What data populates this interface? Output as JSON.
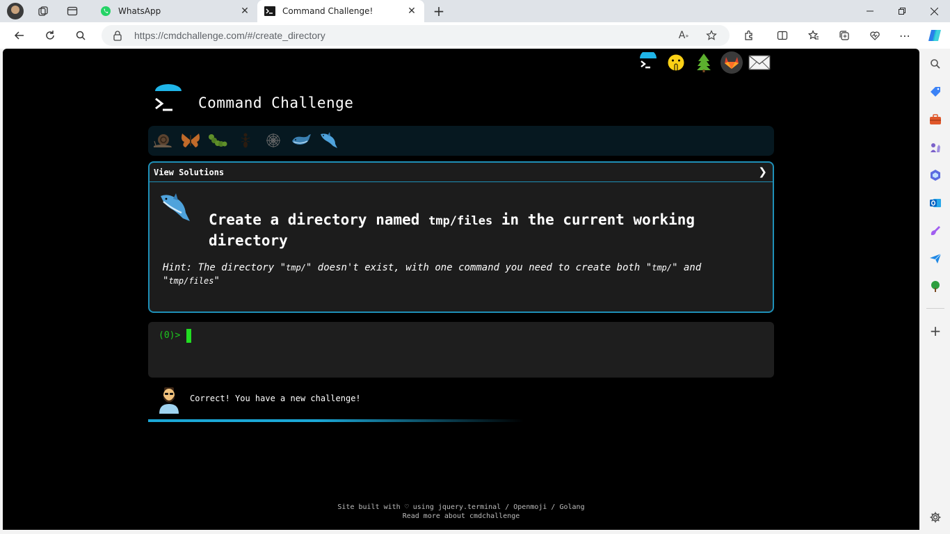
{
  "browser": {
    "tabs": [
      {
        "title": "WhatsApp",
        "active": false
      },
      {
        "title": "Command Challenge!",
        "active": true
      }
    ],
    "url": "https://cmdchallenge.com/#/create_directory",
    "accent_color": "#0067c0"
  },
  "page": {
    "site_title": "Command Challenge",
    "view_solutions_label": "View Solutions",
    "challenge": {
      "text_before": "Create a directory named",
      "code": "tmp/files",
      "text_after": "in the current working directory",
      "hint_prefix": "Hint: The directory \"",
      "hint_code1": "tmp/",
      "hint_mid": "\" doesn't exist, with one command you need to create both \"",
      "hint_code2": "tmp/",
      "hint_mid2": "\" and \"",
      "hint_code3": "tmp/files",
      "hint_end": "\""
    },
    "terminal": {
      "prompt": "(0)>"
    },
    "message": "Correct! You have a new challenge!",
    "footer_line1": "Site built with ♡ using jquery.terminal / Openmoji / Golang",
    "footer_line2": "Read more about cmdchallenge"
  },
  "icons": {
    "top_links": [
      "terminal-logo-icon",
      "shushing-face-icon",
      "evergreen-tree-icon",
      "gitlab-fox-icon",
      "envelope-icon"
    ],
    "levels": [
      "snail-icon",
      "butterfly-icon",
      "caterpillar-icon",
      "ant-icon",
      "spider-web-icon",
      "whale-icon",
      "dolphin-icon"
    ]
  },
  "colors": {
    "page_bg": "#000000",
    "challenge_border": "#1e90b8",
    "terminal_green": "#1ec91e",
    "level_bar_bg": "#061820"
  }
}
